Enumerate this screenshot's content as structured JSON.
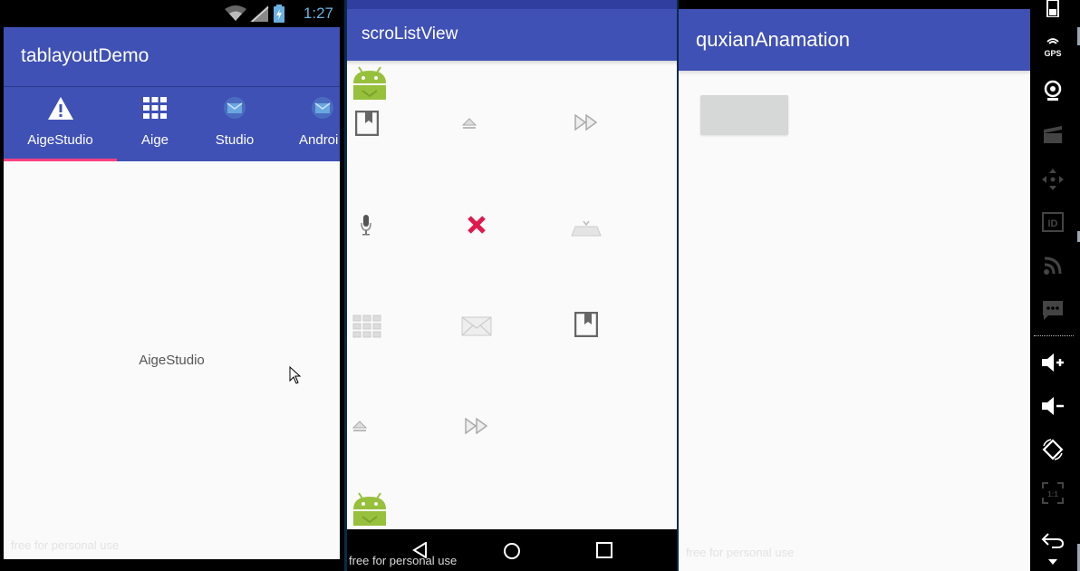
{
  "screen1": {
    "status_time": "1:27",
    "app_title": "tablayoutDemo",
    "tabs": [
      {
        "label": "AigeStudio",
        "icon": "warning-icon",
        "selected": true
      },
      {
        "label": "Aige",
        "icon": "grid-icon",
        "selected": false
      },
      {
        "label": "Studio",
        "icon": "email-icon",
        "selected": false
      },
      {
        "label": "Androi",
        "icon": "email-icon",
        "selected": false
      }
    ],
    "content_text": "AigeStudio",
    "watermark": "free for personal use",
    "colors": {
      "primary": "#3f51b5",
      "accent": "#ff4081",
      "status_time": "#6ab1e0"
    }
  },
  "screen2": {
    "app_title": "scroListView",
    "grid_icons": [
      "android-icon",
      "bookmark-icon",
      "eject-icon",
      "fast-forward-icon",
      "microphone-icon",
      "close-icon",
      "dock-icon",
      "dialpad-icon",
      "email-icon",
      "bookmark-icon",
      "eject-icon",
      "fast-forward-icon",
      "android-icon"
    ],
    "nav_buttons": [
      "back-icon",
      "home-icon",
      "recents-icon"
    ],
    "watermark": "free for personal use"
  },
  "screen3": {
    "app_title": "quxianAnamation",
    "button_label": "",
    "watermark": "free for personal use"
  },
  "sidebar": {
    "buttons": [
      "battery-icon",
      "gps-icon",
      "camera-icon",
      "clapper-icon",
      "move-icon",
      "id-icon",
      "rss-icon",
      "message-icon",
      "volume-up-icon",
      "volume-down-icon",
      "rotate-icon",
      "scale-icon",
      "back-icon"
    ],
    "gps_label": "GPS",
    "id_label": "ID",
    "scale_label": "1:1"
  }
}
